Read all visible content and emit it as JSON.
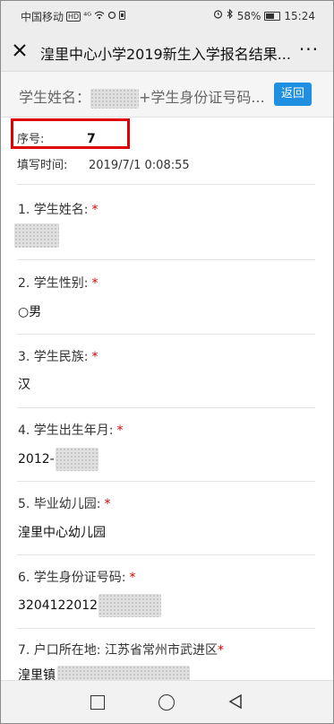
{
  "status_bar": {
    "carrier": "中国移动",
    "hd_badge": "HD",
    "signal": "⁴ᴳ",
    "battery_percent": "58%",
    "time": "15:24",
    "icons": [
      "wifi-icon",
      "alarm-icon",
      "bluetooth-icon",
      "battery-icon"
    ]
  },
  "title_bar": {
    "title": "湟里中心小学2019新生入学报名结果...",
    "more": "···"
  },
  "search": {
    "prefix": "学生姓名：",
    "suffix": "+学生身份证号码...",
    "back_label": "返回"
  },
  "record": {
    "seq_label": "序号:",
    "seq_value": "7",
    "time_label": "填写时间:",
    "time_value": "2019/7/1 0:08:55"
  },
  "fields": [
    {
      "label": "1. 学生姓名:",
      "required": "*",
      "answer": ""
    },
    {
      "label": "2. 学生性别:",
      "required": "*",
      "answer": "○男"
    },
    {
      "label": "3. 学生民族:",
      "required": "*",
      "answer": "汉"
    },
    {
      "label": "4. 学生出生年月:",
      "required": "*",
      "answer": "2012-"
    },
    {
      "label": "5. 毕业幼儿园:",
      "required": "*",
      "answer": "湟里中心幼儿园"
    },
    {
      "label": "6. 学生身份证号码:",
      "required": "*",
      "answer": "3204122012"
    },
    {
      "label": "7. 户口所在地:  江苏省常州市武进区",
      "required": "*",
      "answer": "湟里镇"
    }
  ],
  "colors": {
    "accent": "#1e8fe1",
    "highlight": "#e00000"
  }
}
